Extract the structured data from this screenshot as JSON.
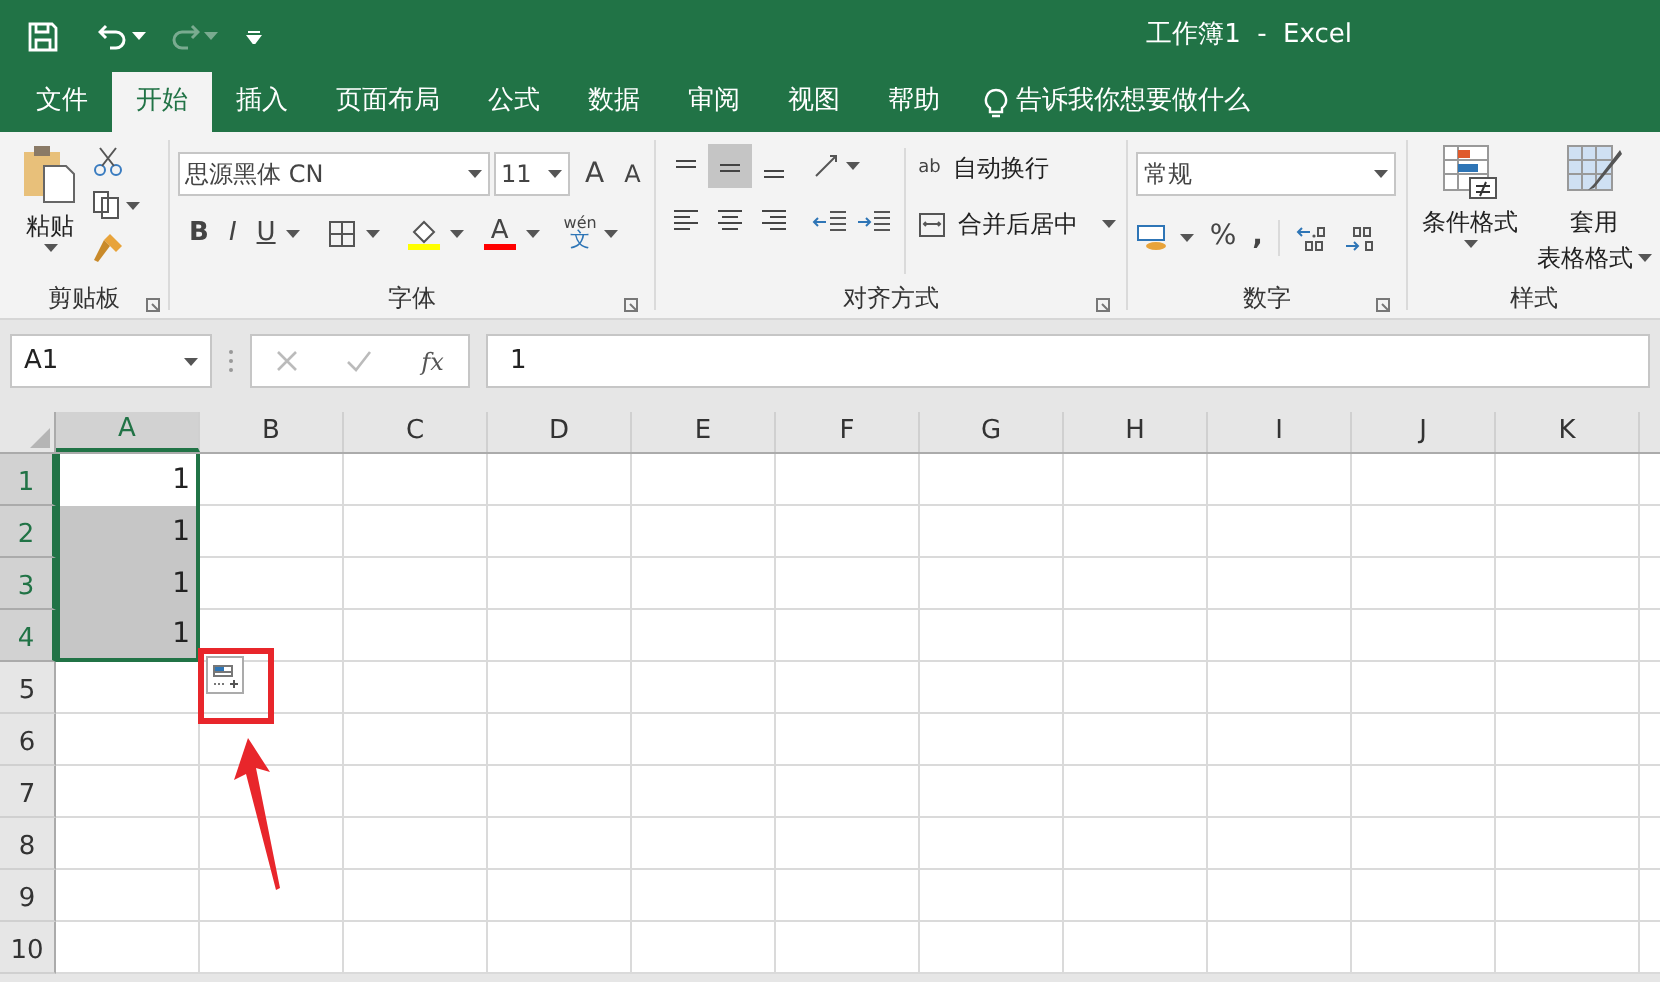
{
  "title_bar": {
    "title": "工作簿1  -  Excel"
  },
  "ribbon_tabs": [
    {
      "label": "文件",
      "selected": false
    },
    {
      "label": "开始",
      "selected": true
    },
    {
      "label": "插入",
      "selected": false
    },
    {
      "label": "页面布局",
      "selected": false
    },
    {
      "label": "公式",
      "selected": false
    },
    {
      "label": "数据",
      "selected": false
    },
    {
      "label": "审阅",
      "selected": false
    },
    {
      "label": "视图",
      "selected": false
    },
    {
      "label": "帮助",
      "selected": false
    }
  ],
  "tell_me": "告诉我你想要做什么",
  "clipboard": {
    "paste": "粘贴",
    "group_label": "剪贴板"
  },
  "font": {
    "font_name": "思源黑体 CN",
    "font_size": "11",
    "grow_glyph": "A",
    "shrink_glyph": "A",
    "bold": "B",
    "italic": "I",
    "underline": "U",
    "font_color_glyph": "A",
    "phonetic_top": "wén",
    "phonetic_bottom": "文",
    "group_label": "字体"
  },
  "alignment": {
    "wrap_glyph": "ab",
    "wrap_text": "自动换行",
    "merge_center": "合并后居中",
    "group_label": "对齐方式"
  },
  "number": {
    "format": "常规",
    "percent": "%",
    "comma": ",",
    "group_label": "数字"
  },
  "styles": {
    "conditional_formatting": "条件格式",
    "format_table_line1": "套用",
    "format_table_line2": "表格格式",
    "group_label": "样式"
  },
  "formula_bar": {
    "name_box": "A1",
    "fx": "fx",
    "formula": "1"
  },
  "columns": [
    {
      "label": "A",
      "selected": true
    },
    {
      "label": "B",
      "selected": false
    },
    {
      "label": "C",
      "selected": false
    },
    {
      "label": "D",
      "selected": false
    },
    {
      "label": "E",
      "selected": false
    },
    {
      "label": "F",
      "selected": false
    },
    {
      "label": "G",
      "selected": false
    },
    {
      "label": "H",
      "selected": false
    },
    {
      "label": "I",
      "selected": false
    },
    {
      "label": "J",
      "selected": false
    },
    {
      "label": "K",
      "selected": false
    }
  ],
  "rows": [
    {
      "label": "1",
      "selected": true,
      "cells": [
        {
          "value": "1",
          "active": true
        }
      ]
    },
    {
      "label": "2",
      "selected": true,
      "cells": [
        {
          "value": "1",
          "active": false
        }
      ]
    },
    {
      "label": "3",
      "selected": true,
      "cells": [
        {
          "value": "1",
          "active": false
        }
      ]
    },
    {
      "label": "4",
      "selected": true,
      "cells": [
        {
          "value": "1",
          "active": false
        }
      ]
    },
    {
      "label": "5",
      "selected": false,
      "cells": []
    },
    {
      "label": "6",
      "selected": false,
      "cells": []
    },
    {
      "label": "7",
      "selected": false,
      "cells": []
    },
    {
      "label": "8",
      "selected": false,
      "cells": []
    },
    {
      "label": "9",
      "selected": false,
      "cells": []
    },
    {
      "label": "10",
      "selected": false,
      "cells": []
    }
  ]
}
